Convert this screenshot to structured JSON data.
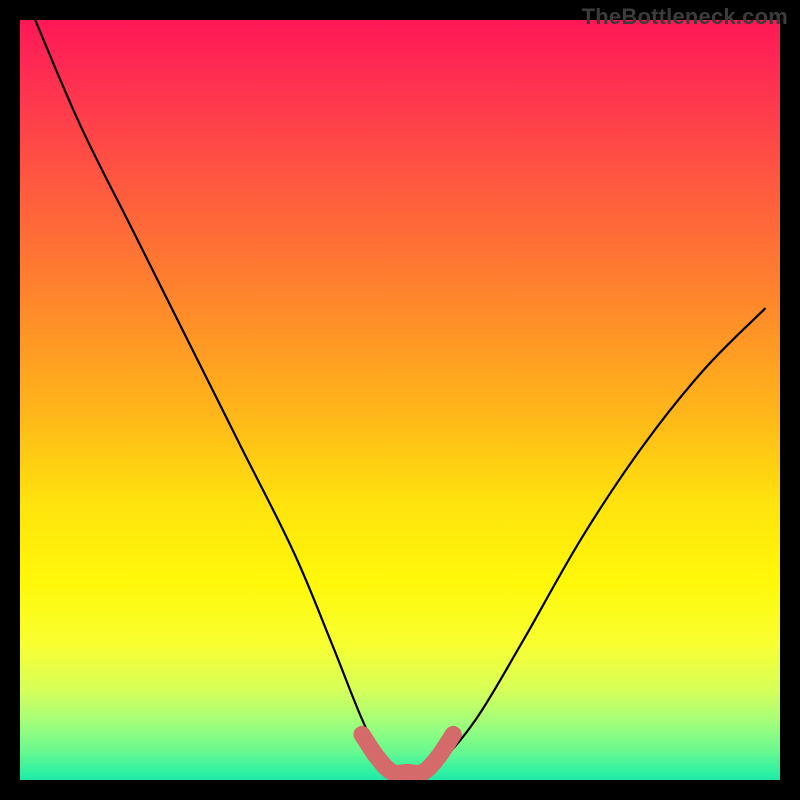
{
  "watermark": "TheBottleneck.com",
  "chart_data": {
    "type": "line",
    "title": "",
    "xlabel": "",
    "ylabel": "",
    "xlim": [
      0,
      100
    ],
    "ylim": [
      0,
      100
    ],
    "grid": false,
    "legend": false,
    "annotations": [],
    "series": [
      {
        "name": "bottleneck-curve",
        "color": "#000000",
        "x": [
          2,
          8,
          15,
          22,
          29,
          36,
          41,
          45,
          48,
          50,
          53,
          55,
          60,
          66,
          74,
          82,
          90,
          98
        ],
        "y": [
          100,
          86,
          72,
          58,
          44,
          30,
          18,
          8,
          2,
          1,
          1,
          2,
          8,
          18,
          32,
          44,
          54,
          62
        ]
      },
      {
        "name": "sweet-spot-band",
        "color": "#d46a6a",
        "x": [
          45,
          47,
          49,
          51,
          53,
          55,
          57
        ],
        "y": [
          6,
          3,
          1,
          1,
          1,
          3,
          6
        ]
      }
    ],
    "gradient_stops": [
      {
        "pos": 0,
        "color": "#ff1756"
      },
      {
        "pos": 22,
        "color": "#ff5a3f"
      },
      {
        "pos": 52,
        "color": "#ffb719"
      },
      {
        "pos": 74,
        "color": "#fff80a"
      },
      {
        "pos": 92,
        "color": "#a8ff78"
      },
      {
        "pos": 100,
        "color": "#20e8a8"
      }
    ]
  }
}
